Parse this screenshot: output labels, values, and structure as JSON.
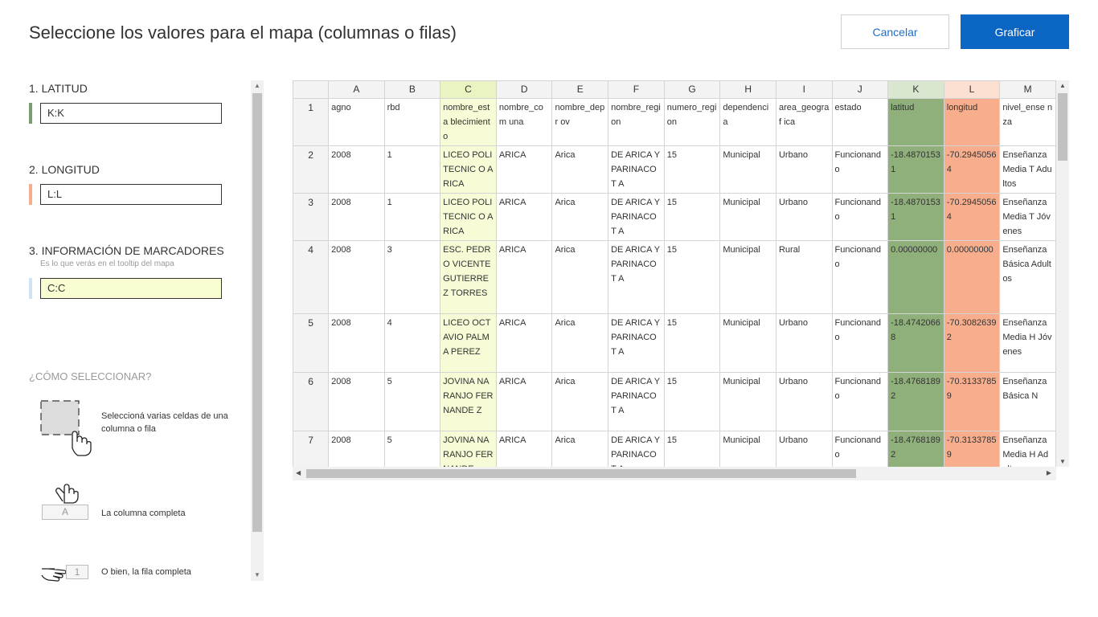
{
  "header": {
    "title": "Seleccione los valores para el mapa (columnas o filas)",
    "cancel_label": "Cancelar",
    "graph_label": "Graficar"
  },
  "sidebar": {
    "latitud": {
      "label": "1. LATITUD",
      "value": "K:K",
      "color": "#7a9e6c"
    },
    "longitud": {
      "label": "2. LONGITUD",
      "value": "L:L",
      "color": "#f8ae8d"
    },
    "markers": {
      "label": "3. INFORMACIÓN DE MARCADORES",
      "sub": "Es lo que verás en el tooltip del mapa",
      "value": "C:C",
      "color": "#cfe3f5"
    },
    "how": {
      "title": "¿CÓMO SELECCIONAR?",
      "tip1": "Seleccioná varias celdas de una columna o fila",
      "tip2_letter": "A",
      "tip2": "La columna completa",
      "tip3_number": "1",
      "tip3": "O bien, la fila completa"
    }
  },
  "grid": {
    "columns": [
      "A",
      "B",
      "C",
      "D",
      "E",
      "F",
      "G",
      "H",
      "I",
      "J",
      "K",
      "L",
      "M"
    ],
    "rows": [
      {
        "num": "1",
        "cells": [
          "agno",
          "rbd",
          "nombre_esta blecimiento",
          "nombre_com una",
          "nombre_depr ov",
          "nombre_regi on",
          "numero_regi on",
          "dependencia",
          "area_geograf ica",
          "estado",
          "latitud",
          "longitud",
          "nivel_ense nza"
        ]
      },
      {
        "num": "2",
        "cells": [
          "2008",
          "1",
          "LICEO POLITECNIC O ARICA",
          "ARICA",
          "Arica",
          "DE ARICA Y PARINACOT A",
          "15",
          "Municipal",
          "Urbano",
          "Funcionando",
          "-18.4870153 1",
          "-70.2945056 4",
          "Enseñanza Media T Adultos"
        ]
      },
      {
        "num": "3",
        "cells": [
          "2008",
          "1",
          "LICEO POLITECNIC O ARICA",
          "ARICA",
          "Arica",
          "DE ARICA Y PARINACOT A",
          "15",
          "Municipal",
          "Urbano",
          "Funcionando",
          "-18.4870153 1",
          "-70.2945056 4",
          "Enseñanza Media T Jóvenes"
        ]
      },
      {
        "num": "4",
        "cells": [
          "2008",
          "3",
          "ESC. PEDRO VICENTE GUTIERREZ TORRES",
          "ARICA",
          "Arica",
          "DE ARICA Y PARINACOT A",
          "15",
          "Municipal",
          "Rural",
          "Funcionando",
          "0.00000000",
          "0.00000000",
          "Enseñanza Básica Adultos"
        ]
      },
      {
        "num": "5",
        "cells": [
          "2008",
          "4",
          "LICEO OCTAVIO PALMA PEREZ",
          "ARICA",
          "Arica",
          "DE ARICA Y PARINACOT A",
          "15",
          "Municipal",
          "Urbano",
          "Funcionando",
          "-18.4742066 8",
          "-70.3082639 2",
          "Enseñanza Media H Jóvenes"
        ]
      },
      {
        "num": "6",
        "cells": [
          "2008",
          "5",
          "JOVINA NARANJO FERNANDE Z",
          "ARICA",
          "Arica",
          "DE ARICA Y PARINACOT A",
          "15",
          "Municipal",
          "Urbano",
          "Funcionando",
          "-18.4768189 2",
          "-70.3133785 9",
          "Enseñanza Básica N"
        ]
      },
      {
        "num": "7",
        "cells": [
          "2008",
          "5",
          "JOVINA NARANJO FERNANDE",
          "ARICA",
          "Arica",
          "DE ARICA Y PARINACOT A",
          "15",
          "Municipal",
          "Urbano",
          "Funcionando",
          "-18.4768189 2",
          "-70.3133785 9",
          "Enseñanza Media H Adultos"
        ]
      }
    ]
  }
}
